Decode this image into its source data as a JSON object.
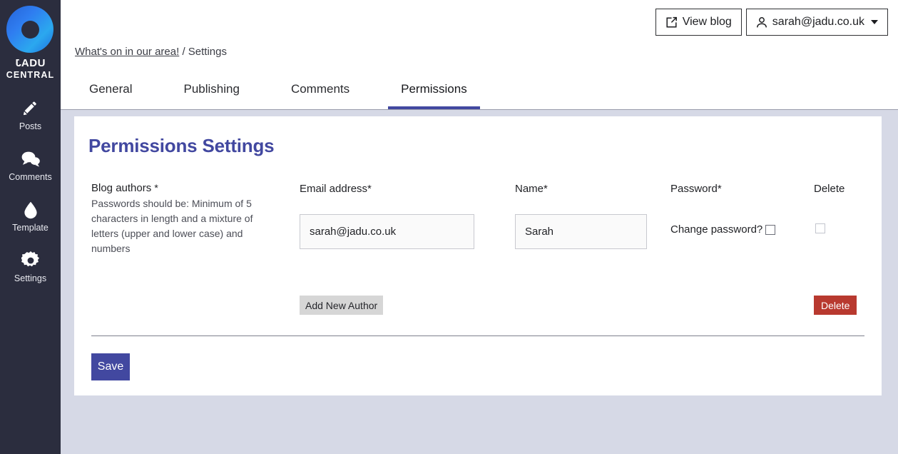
{
  "sidebar": {
    "brand": {
      "line1": "JADU",
      "line2": "CENTRAL",
      "logo_icon": "jadu-ring-logo"
    },
    "items": [
      {
        "label": "Posts",
        "icon": "pencil-icon"
      },
      {
        "label": "Comments",
        "icon": "comments-icon"
      },
      {
        "label": "Template",
        "icon": "droplet-icon"
      },
      {
        "label": "Settings",
        "icon": "gear-icon"
      }
    ]
  },
  "topbar": {
    "view_blog_label": "View blog",
    "view_blog_icon": "external-link-icon",
    "account_label": "sarah@jadu.co.uk",
    "account_icon": "person-icon",
    "account_caret_icon": "caret-down-icon"
  },
  "breadcrumb": {
    "link": "What's on in our area!",
    "separator": "/",
    "current": "Settings"
  },
  "tabs": [
    {
      "label": "General",
      "active": false
    },
    {
      "label": "Publishing",
      "active": false
    },
    {
      "label": "Comments",
      "active": false
    },
    {
      "label": "Permissions",
      "active": true
    }
  ],
  "main": {
    "title": "Permissions Settings",
    "blog_authors": {
      "label": "Blog authors",
      "required_marker": "*",
      "help_text": "Passwords should be: Minimum of 5 characters in length and a mixture of letters (upper and lower case) and numbers"
    },
    "columns": {
      "email": "Email address*",
      "name": "Name*",
      "password": "Password*",
      "delete": "Delete"
    },
    "rows": [
      {
        "email_value": "sarah@jadu.co.uk",
        "email_placeholder": "",
        "name_value": "Sarah",
        "name_placeholder": "",
        "change_password_label": "Change password?",
        "change_password_checked": false,
        "delete_checked": false,
        "delete_button_label": "Delete"
      }
    ],
    "add_author_label": "Add New Author",
    "save_label": "Save"
  },
  "colors": {
    "accent": "#4248a0",
    "sidebar_bg": "#2b2d3e",
    "page_bg": "#d6d9e6",
    "danger": "#b8392f",
    "card_bg": "#ffffff"
  }
}
